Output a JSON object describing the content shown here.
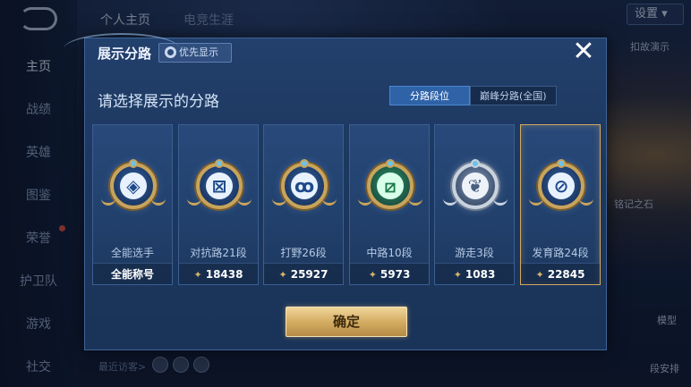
{
  "background": {
    "top_tabs": [
      "个人主页",
      "电竞生涯"
    ],
    "nav_items": [
      "主页",
      "战绩",
      "英雄",
      "图鉴",
      "荣誉",
      "护卫队",
      "游戏",
      "社交"
    ],
    "settings_label": "设置",
    "side_labels": [
      "扣故演示",
      "铭记之石",
      "模型",
      "段安排"
    ],
    "visitors_label": "最近访客>"
  },
  "dialog": {
    "title": "展示分路",
    "priority_button": "优先显示",
    "close_icon": "close-icon",
    "subtitle": "请选择展示的分路",
    "toggle": {
      "active": "分路段位",
      "inactive": "巅峰分路(全国)"
    },
    "confirm_button": "确定",
    "accent_gold": "#d2a962"
  },
  "cards": [
    {
      "label": "全能选手",
      "score": "全能称号",
      "show_rank_icon": false,
      "icon": "all-round-emblem-icon"
    },
    {
      "label": "对抗路21段",
      "score": "18438",
      "show_rank_icon": true,
      "icon": "clash-lane-emblem-icon"
    },
    {
      "label": "打野26段",
      "score": "25927",
      "show_rank_icon": true,
      "icon": "jungle-emblem-icon"
    },
    {
      "label": "中路10段",
      "score": "5973",
      "show_rank_icon": true,
      "icon": "mid-lane-emblem-icon"
    },
    {
      "label": "游走3段",
      "score": "1083",
      "show_rank_icon": true,
      "icon": "roam-emblem-icon"
    },
    {
      "label": "发育路24段",
      "score": "22845",
      "show_rank_icon": true,
      "icon": "farm-lane-emblem-icon",
      "selected": true
    }
  ]
}
